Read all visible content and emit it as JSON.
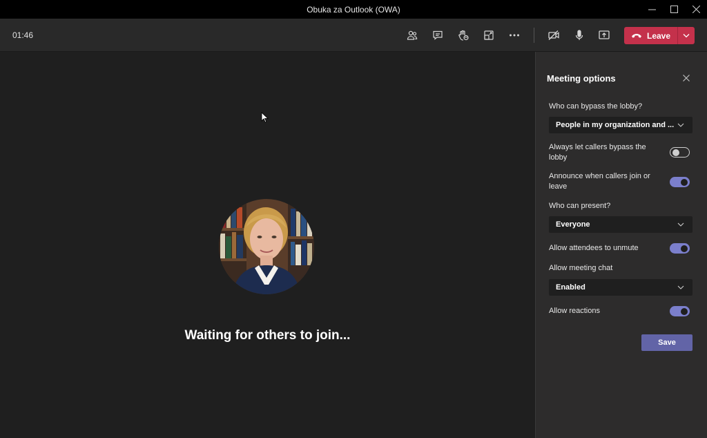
{
  "window": {
    "title": "Obuka za Outlook (OWA)"
  },
  "toolbar": {
    "timer": "01:46",
    "icons": [
      "people-icon",
      "chat-icon",
      "raise-hand-icon",
      "breakout-rooms-icon",
      "more-actions-icon",
      "camera-off-icon",
      "microphone-icon",
      "share-screen-icon"
    ],
    "leave_label": "Leave",
    "leave_color": "#c4314b"
  },
  "stage": {
    "waiting_text": "Waiting for others to join..."
  },
  "panel": {
    "title": "Meeting options",
    "bypass_lobby_label": "Who can bypass the lobby?",
    "bypass_lobby_value": "People in my organization and ...",
    "callers_bypass_label": "Always let callers bypass the lobby",
    "callers_bypass_on": false,
    "announce_label": "Announce when callers join or leave",
    "announce_on": true,
    "present_label": "Who can present?",
    "present_value": "Everyone",
    "unmute_label": "Allow attendees to unmute",
    "unmute_on": true,
    "chat_label": "Allow meeting chat",
    "chat_value": "Enabled",
    "reactions_label": "Allow reactions",
    "reactions_on": true,
    "save_label": "Save",
    "accent_color": "#6264a7",
    "toggle_on_color": "#7b7fcc"
  }
}
